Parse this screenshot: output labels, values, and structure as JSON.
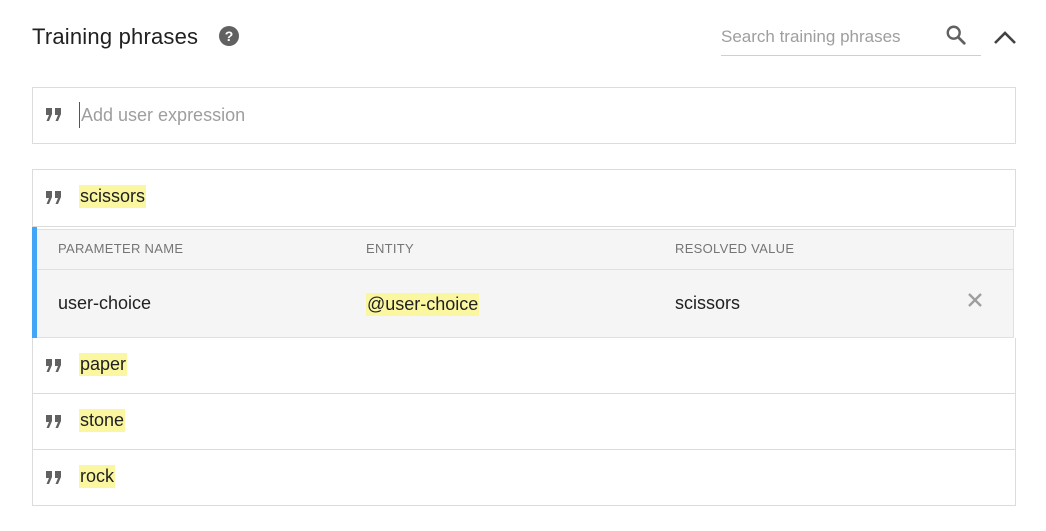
{
  "section": {
    "title": "Training phrases",
    "help_icon": "help-circle-icon",
    "search_placeholder": "Search training phrases",
    "search_icon": "search-icon",
    "collapse_icon": "chevron-up-icon"
  },
  "add_expression": {
    "placeholder": "Add user expression",
    "icon": "quote-icon"
  },
  "phrases": [
    {
      "text": "scissors",
      "selected": true
    },
    {
      "text": "paper"
    },
    {
      "text": "stone"
    },
    {
      "text": "rock"
    }
  ],
  "parameter_table": {
    "headers": [
      "PARAMETER NAME",
      "ENTITY",
      "RESOLVED VALUE"
    ],
    "rows": [
      {
        "parameter_name": "user-choice",
        "entity": "@user-choice",
        "resolved_value": "scissors",
        "remove_icon": "close-icon"
      }
    ]
  },
  "colors": {
    "accent": "#42a5f5",
    "highlight": "#fbf7a1",
    "icon": "#616161"
  }
}
